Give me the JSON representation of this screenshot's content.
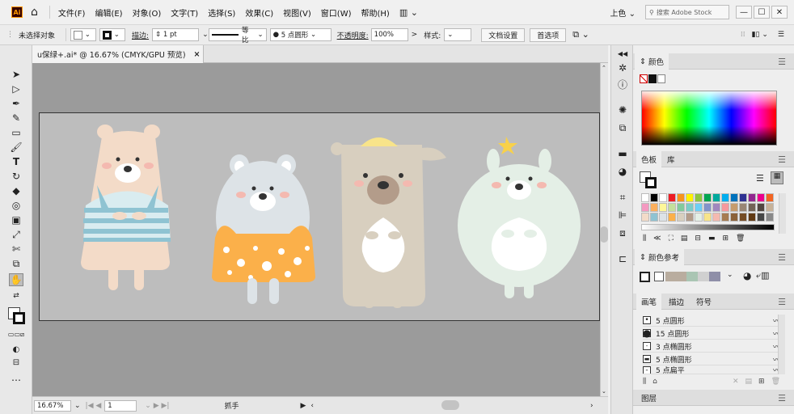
{
  "app": {
    "logo": "Ai"
  },
  "menu": [
    "文件(F)",
    "编辑(E)",
    "对象(O)",
    "文字(T)",
    "选择(S)",
    "效果(C)",
    "视图(V)",
    "窗口(W)",
    "帮助(H)"
  ],
  "menubar_right": {
    "workspace": "上色",
    "search_placeholder": "搜索 Adobe Stock"
  },
  "window_controls": [
    "—",
    "☐",
    "✕"
  ],
  "controlbar": {
    "selection": "未选择对象",
    "stroke_label": "描边:",
    "stroke_value": "1 pt",
    "profile": "等比",
    "brush": "5 点圆形",
    "opacity_label": "不透明度:",
    "opacity_value": "100%",
    "style_label": "样式:",
    "doc_setup": "文档设置",
    "preferences": "首选项"
  },
  "document": {
    "tab_title": "u保绿+.ai* @ 16.67% (CMYK/GPU 预览)",
    "tab_close": "×"
  },
  "status": {
    "zoom": "16.67%",
    "page": "1",
    "tool": "抓手"
  },
  "colors": {
    "bear1": "#f3dbc8",
    "stripe": "#8fc3d2",
    "cheek": "#f4b9b0",
    "bear2": "#dde3e7",
    "orange": "#fbb04a",
    "bear3": "#d8cfbf",
    "hat": "#f8e48a",
    "muzzle": "#b39c8a",
    "bunny": "#e4efe6",
    "artboard": "#bdbdbd",
    "pasteboard": "#9b9b9b"
  },
  "panels": {
    "color": {
      "tab": "颜色"
    },
    "swatches": {
      "tabs": [
        "色板",
        "库"
      ]
    },
    "color_guide": {
      "tab": "颜色参考"
    },
    "brushes": {
      "tabs": [
        "画笔",
        "描边",
        "符号"
      ],
      "items": [
        "5 点圆形",
        "15 点圆形",
        "3 点椭圆形",
        "5 点椭圆形",
        "5 点扁平"
      ]
    },
    "layers": {
      "tab": "图层"
    }
  }
}
